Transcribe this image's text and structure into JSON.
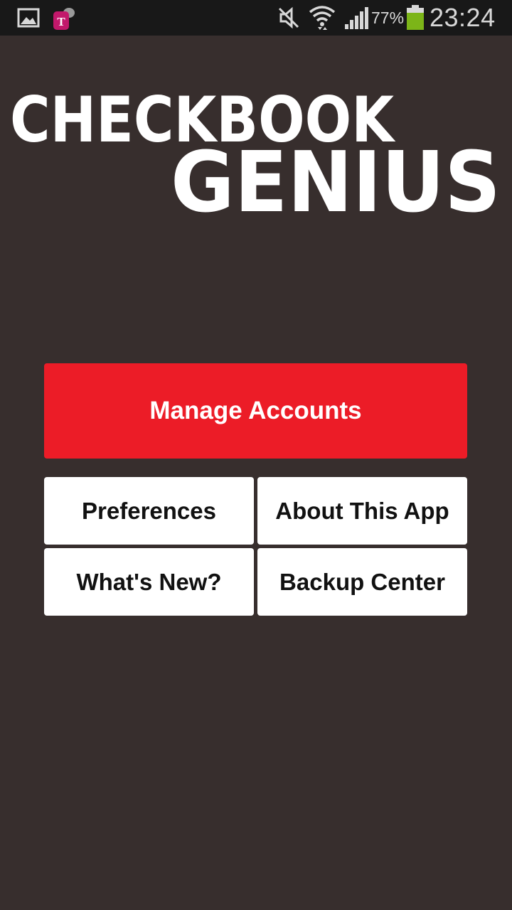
{
  "status_bar": {
    "left_icons": [
      "gallery-icon",
      "t-mobile-keys-icon"
    ],
    "right_icons": [
      "mute-icon",
      "wifi-icon",
      "signal-icon",
      "battery-icon"
    ],
    "battery_percent": "77%",
    "time": "23:24"
  },
  "logo": {
    "line1": "CHECKBOOK",
    "line2": "GENIUS"
  },
  "menu": {
    "manage_accounts": "Manage Accounts",
    "preferences": "Preferences",
    "about": "About This App",
    "whats_new": "What's New?",
    "backup_center": "Backup Center"
  },
  "colors": {
    "background": "#372e2d",
    "primary_button": "#ec1c27",
    "secondary_button": "#ffffff",
    "battery_fill": "#7cb518",
    "carrier_magenta": "#c2186b"
  }
}
